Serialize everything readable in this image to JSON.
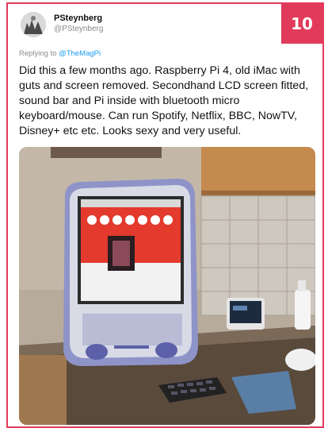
{
  "badge": "10",
  "author": {
    "name": "PSteynberg",
    "handle": "@PSteynberg"
  },
  "replying": {
    "prefix": "Replying to ",
    "target": "@TheMagPi"
  },
  "tweet_text": "Did this a few months ago. Raspberry Pi 4, old iMac with guts and screen removed. Secondhand LCD screen fitted, sound bar and Pi inside with bluetooth micro keyboard/mouse. Can run Spotify, Netflix, BBC, NowTV, Disney+ etc etc. Looks sexy and very useful.",
  "photo": {
    "subject": "old iMac with LCD screen, keyboard and smart display on kitchen counter"
  },
  "colors": {
    "accent": "#e23a5b",
    "link": "#1d9bf0"
  }
}
